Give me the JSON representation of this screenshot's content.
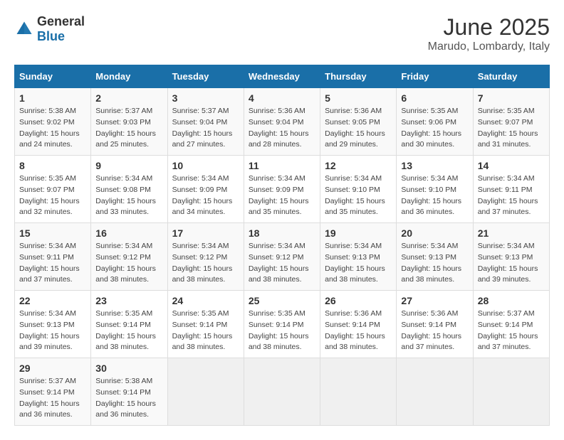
{
  "header": {
    "logo_general": "General",
    "logo_blue": "Blue",
    "title": "June 2025",
    "subtitle": "Marudo, Lombardy, Italy"
  },
  "calendar": {
    "columns": [
      "Sunday",
      "Monday",
      "Tuesday",
      "Wednesday",
      "Thursday",
      "Friday",
      "Saturday"
    ],
    "rows": [
      [
        {
          "day": "1",
          "info": "Sunrise: 5:38 AM\nSunset: 9:02 PM\nDaylight: 15 hours\nand 24 minutes."
        },
        {
          "day": "2",
          "info": "Sunrise: 5:37 AM\nSunset: 9:03 PM\nDaylight: 15 hours\nand 25 minutes."
        },
        {
          "day": "3",
          "info": "Sunrise: 5:37 AM\nSunset: 9:04 PM\nDaylight: 15 hours\nand 27 minutes."
        },
        {
          "day": "4",
          "info": "Sunrise: 5:36 AM\nSunset: 9:04 PM\nDaylight: 15 hours\nand 28 minutes."
        },
        {
          "day": "5",
          "info": "Sunrise: 5:36 AM\nSunset: 9:05 PM\nDaylight: 15 hours\nand 29 minutes."
        },
        {
          "day": "6",
          "info": "Sunrise: 5:35 AM\nSunset: 9:06 PM\nDaylight: 15 hours\nand 30 minutes."
        },
        {
          "day": "7",
          "info": "Sunrise: 5:35 AM\nSunset: 9:07 PM\nDaylight: 15 hours\nand 31 minutes."
        }
      ],
      [
        {
          "day": "8",
          "info": "Sunrise: 5:35 AM\nSunset: 9:07 PM\nDaylight: 15 hours\nand 32 minutes."
        },
        {
          "day": "9",
          "info": "Sunrise: 5:34 AM\nSunset: 9:08 PM\nDaylight: 15 hours\nand 33 minutes."
        },
        {
          "day": "10",
          "info": "Sunrise: 5:34 AM\nSunset: 9:09 PM\nDaylight: 15 hours\nand 34 minutes."
        },
        {
          "day": "11",
          "info": "Sunrise: 5:34 AM\nSunset: 9:09 PM\nDaylight: 15 hours\nand 35 minutes."
        },
        {
          "day": "12",
          "info": "Sunrise: 5:34 AM\nSunset: 9:10 PM\nDaylight: 15 hours\nand 35 minutes."
        },
        {
          "day": "13",
          "info": "Sunrise: 5:34 AM\nSunset: 9:10 PM\nDaylight: 15 hours\nand 36 minutes."
        },
        {
          "day": "14",
          "info": "Sunrise: 5:34 AM\nSunset: 9:11 PM\nDaylight: 15 hours\nand 37 minutes."
        }
      ],
      [
        {
          "day": "15",
          "info": "Sunrise: 5:34 AM\nSunset: 9:11 PM\nDaylight: 15 hours\nand 37 minutes."
        },
        {
          "day": "16",
          "info": "Sunrise: 5:34 AM\nSunset: 9:12 PM\nDaylight: 15 hours\nand 38 minutes."
        },
        {
          "day": "17",
          "info": "Sunrise: 5:34 AM\nSunset: 9:12 PM\nDaylight: 15 hours\nand 38 minutes."
        },
        {
          "day": "18",
          "info": "Sunrise: 5:34 AM\nSunset: 9:12 PM\nDaylight: 15 hours\nand 38 minutes."
        },
        {
          "day": "19",
          "info": "Sunrise: 5:34 AM\nSunset: 9:13 PM\nDaylight: 15 hours\nand 38 minutes."
        },
        {
          "day": "20",
          "info": "Sunrise: 5:34 AM\nSunset: 9:13 PM\nDaylight: 15 hours\nand 38 minutes."
        },
        {
          "day": "21",
          "info": "Sunrise: 5:34 AM\nSunset: 9:13 PM\nDaylight: 15 hours\nand 39 minutes."
        }
      ],
      [
        {
          "day": "22",
          "info": "Sunrise: 5:34 AM\nSunset: 9:13 PM\nDaylight: 15 hours\nand 39 minutes."
        },
        {
          "day": "23",
          "info": "Sunrise: 5:35 AM\nSunset: 9:14 PM\nDaylight: 15 hours\nand 38 minutes."
        },
        {
          "day": "24",
          "info": "Sunrise: 5:35 AM\nSunset: 9:14 PM\nDaylight: 15 hours\nand 38 minutes."
        },
        {
          "day": "25",
          "info": "Sunrise: 5:35 AM\nSunset: 9:14 PM\nDaylight: 15 hours\nand 38 minutes."
        },
        {
          "day": "26",
          "info": "Sunrise: 5:36 AM\nSunset: 9:14 PM\nDaylight: 15 hours\nand 38 minutes."
        },
        {
          "day": "27",
          "info": "Sunrise: 5:36 AM\nSunset: 9:14 PM\nDaylight: 15 hours\nand 37 minutes."
        },
        {
          "day": "28",
          "info": "Sunrise: 5:37 AM\nSunset: 9:14 PM\nDaylight: 15 hours\nand 37 minutes."
        }
      ],
      [
        {
          "day": "29",
          "info": "Sunrise: 5:37 AM\nSunset: 9:14 PM\nDaylight: 15 hours\nand 36 minutes."
        },
        {
          "day": "30",
          "info": "Sunrise: 5:38 AM\nSunset: 9:14 PM\nDaylight: 15 hours\nand 36 minutes."
        },
        {
          "day": "",
          "info": ""
        },
        {
          "day": "",
          "info": ""
        },
        {
          "day": "",
          "info": ""
        },
        {
          "day": "",
          "info": ""
        },
        {
          "day": "",
          "info": ""
        }
      ]
    ]
  }
}
